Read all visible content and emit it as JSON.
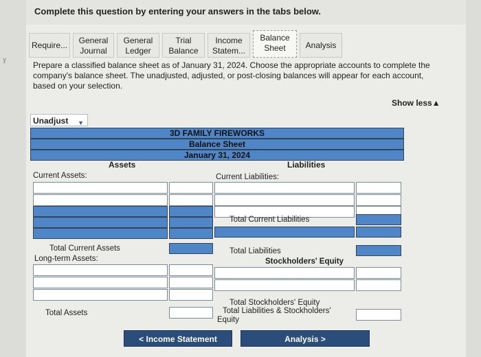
{
  "header": {
    "title": "Complete this question by entering your answers in the tabs below."
  },
  "tabs": [
    {
      "label": "Require...",
      "single": true
    },
    {
      "line1": "General",
      "line2": "Journal"
    },
    {
      "line1": "General",
      "line2": "Ledger"
    },
    {
      "line1": "Trial",
      "line2": "Balance"
    },
    {
      "line1": "Income",
      "line2": "Statem..."
    },
    {
      "line1": "Balance",
      "line2": "Sheet",
      "active": true
    },
    {
      "label": "Analysis",
      "single": true
    }
  ],
  "instructions": "Prepare a classified balance sheet as of January 31, 2024. Choose the appropriate accounts to complete the company's balance sheet. The unadjusted, adjusted, or post-closing balances will appear for each account, based on your selection.",
  "show_less": "Show less▲",
  "dropdown": {
    "selected": "Unadjust"
  },
  "sheet": {
    "company": "3D FAMILY FIREWORKS",
    "statement": "Balance Sheet",
    "date": "January 31, 2024",
    "assets_header": "Assets",
    "liabilities_header": "Liabilities",
    "current_assets": "Current Assets:",
    "total_current_assets": "Total Current Assets",
    "long_term_assets": "Long-term Assets:",
    "total_assets": "Total Assets",
    "current_liabilities": "Current Liabilities:",
    "total_current_liabilities": "Total Current Liabilities",
    "total_liabilities": "Total Liabilities",
    "stockholders_equity": "Stockholders' Equity",
    "total_stockholders_equity": "Total Stockholders' Equity",
    "total_liab_equity_1": "Total Liabilities & Stockholders'",
    "total_liab_equity_2": "Equity"
  },
  "nav": {
    "prev": "< Income Statement",
    "next": "Analysis >"
  },
  "colors": {
    "accent": "#4e86c8",
    "button": "#2a4d7a"
  }
}
